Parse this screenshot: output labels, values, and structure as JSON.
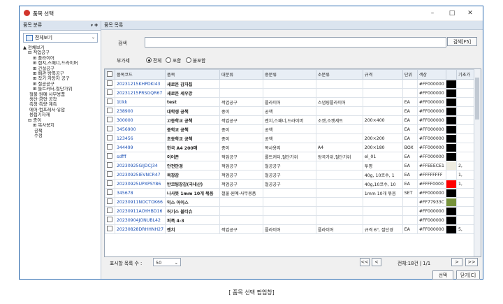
{
  "window": {
    "title": "품목 선택",
    "controls": [
      "–",
      "□",
      "✕"
    ]
  },
  "left_panel": {
    "header": "품목 분류",
    "header_tools": "▾ ✚",
    "select_label": "전체보기",
    "tree": [
      {
        "label": "전체보기",
        "indent": 0,
        "prefix": "▲"
      },
      {
        "label": "적업공구",
        "indent": 1,
        "prefix": "⊟"
      },
      {
        "label": "플라이어",
        "indent": 2,
        "prefix": "⊞"
      },
      {
        "label": "렌치,스패너,드라이버",
        "indent": 2,
        "prefix": "⊞"
      },
      {
        "label": "건설공구",
        "indent": 2,
        "prefix": "⊞"
      },
      {
        "label": "배관·방폭공구",
        "indent": 2,
        "prefix": "⊞"
      },
      {
        "label": "작기·자동차 공구",
        "indent": 2,
        "prefix": "⊞"
      },
      {
        "label": "절공공구",
        "indent": 2,
        "prefix": "⊞"
      },
      {
        "label": "툴트커터,절단가위",
        "indent": 2,
        "prefix": "⊞"
      },
      {
        "label": "철물·원예·사무용품",
        "indent": 1,
        "prefix": ""
      },
      {
        "label": "생산·금형·공작",
        "indent": 1,
        "prefix": ""
      },
      {
        "label": "측정·측량·계측",
        "indent": 1,
        "prefix": ""
      },
      {
        "label": "에어·컴프레서·유압",
        "indent": 1,
        "prefix": ""
      },
      {
        "label": "용접기자재",
        "indent": 1,
        "prefix": ""
      },
      {
        "label": "종이",
        "indent": 1,
        "prefix": "⊟"
      },
      {
        "label": "복사용지",
        "indent": 2,
        "prefix": "⊞"
      },
      {
        "label": "공책",
        "indent": 2,
        "prefix": ""
      },
      {
        "label": "수정",
        "indent": 2,
        "prefix": ""
      }
    ]
  },
  "right_panel": {
    "header": "품목 목록",
    "search_label": "검색",
    "search_button": "검색[F5]",
    "subtax_label": "부가세",
    "radios": [
      {
        "label": "전체",
        "checked": true
      },
      {
        "label": "포함",
        "checked": false
      },
      {
        "label": "불포함",
        "checked": false
      }
    ],
    "columns": [
      "품목코드",
      "품목",
      "대분류",
      "중분류",
      "소분류",
      "규격",
      "단위",
      "색상",
      "",
      "기초가"
    ],
    "rows": [
      {
        "code": "20231215KHPDKI43",
        "name": "새로운 감자칩",
        "l": "",
        "m": "",
        "s": "",
        "spec": "",
        "unit": "",
        "hex": "#FF000000",
        "swatch": "#000000",
        "price": ""
      },
      {
        "code": "20231215PRSGQR67",
        "name": "새로운 세우깡",
        "l": "",
        "m": "",
        "s": "",
        "spec": "",
        "unit": "",
        "hex": "#FF000000",
        "swatch": "#000000",
        "price": ""
      },
      {
        "code": "1tikk",
        "name": "test",
        "l": "적업공구",
        "m": "플라이어",
        "s": "스냅링플라이어",
        "spec": "",
        "unit": "EA",
        "hex": "#FF000000",
        "swatch": "#000000",
        "price": ""
      },
      {
        "code": "238900",
        "name": "대학생 공책",
        "l": "종이",
        "m": "공책",
        "s": "",
        "spec": "",
        "unit": "EA",
        "hex": "#FF000000",
        "swatch": "#000000",
        "price": ""
      },
      {
        "code": "300000",
        "name": "고등학교 공책",
        "l": "적업공구",
        "m": "렌치,스패너,드라이버",
        "s": "소켓,소켓세트",
        "spec": "200×400",
        "unit": "EA",
        "hex": "#FF000000",
        "swatch": "#000000",
        "price": ""
      },
      {
        "code": "3456900",
        "name": "중학교 공책",
        "l": "종이",
        "m": "공책",
        "s": "",
        "spec": "",
        "unit": "EA",
        "hex": "#FF000000",
        "swatch": "#000000",
        "price": ""
      },
      {
        "code": "123456",
        "name": "초등학교 공책",
        "l": "종이",
        "m": "공책",
        "s": "",
        "spec": "200×200",
        "unit": "EA",
        "hex": "#FF000000",
        "swatch": "#000000",
        "price": ""
      },
      {
        "code": "344499",
        "name": "한국 A4 200매",
        "l": "종이",
        "m": "복사용지",
        "s": "A4",
        "spec": "200×180",
        "unit": "BOX",
        "hex": "#FF000000",
        "swatch": "#000000",
        "price": ""
      },
      {
        "code": "sdfff",
        "name": "이어폰",
        "l": "적업공구",
        "m": "롤트커터,절단가위",
        "s": "왕곡가위,절단가위",
        "spec": "el_01",
        "unit": "EA",
        "hex": "#FF000000",
        "swatch": "#000000",
        "price": ""
      },
      {
        "code": "20230925GIJDCJ34",
        "name": "안전안경",
        "l": "적업공구",
        "m": "철공공구",
        "s": "",
        "spec": "투명",
        "unit": "EA",
        "hex": "#FFEEECE1",
        "swatch": "#EEECE1",
        "price": "2,"
      },
      {
        "code": "20230925IEVNCR47",
        "name": "목장갑",
        "l": "적업공구",
        "m": "철공공구",
        "s": "",
        "spec": "40g, 10코수, 1",
        "unit": "EA",
        "hex": "#FFFFFFFF",
        "swatch": "#FFFFFF",
        "price": "1,"
      },
      {
        "code": "20230925UPXPSY86",
        "name": "반코팅장갑(국내산)",
        "l": "적업공구",
        "m": "철공공구",
        "s": "",
        "spec": "40g,10코수, 10",
        "unit": "EA",
        "hex": "#FFFF0000",
        "swatch": "#FF0000",
        "price": "1,"
      },
      {
        "code": "345678",
        "name": "나사못 1mm 10개 묶음",
        "l": "철물·원예·사무용품",
        "m": "",
        "s": "",
        "spec": "1mm 10개 묶음",
        "unit": "SET",
        "hex": "#FF000000",
        "swatch": "#000000",
        "price": ""
      },
      {
        "code": "20230911NOCTOK66",
        "name": "믹스 아이스",
        "l": "",
        "m": "",
        "s": "",
        "spec": "",
        "unit": "",
        "hex": "#FF77933C",
        "swatch": "#77933C",
        "price": ""
      },
      {
        "code": "20230911AOYHBD16",
        "name": "허기스 블티슈",
        "l": "",
        "m": "",
        "s": "",
        "spec": "",
        "unit": "",
        "hex": "#FF000000",
        "swatch": "#000000",
        "price": ""
      },
      {
        "code": "20230904JONUBL42",
        "name": "퍼폭 4-3",
        "l": "",
        "m": "",
        "s": "",
        "spec": "",
        "unit": "",
        "hex": "#FF000000",
        "swatch": "#000000",
        "price": ""
      },
      {
        "code": "20230828DRHHNH27",
        "name": "렌치",
        "l": "적업공구",
        "m": "플라이어",
        "s": "플라이어",
        "spec": "규격 6\", 절단경",
        "unit": "EA",
        "hex": "#FF000000",
        "swatch": "#000000",
        "price": "5,"
      }
    ],
    "footer": {
      "rows_label": "표시할 목록 수 :",
      "rows_value": "50",
      "total": "전체:18건 | 1/1",
      "nav_first": "<<",
      "nav_prev": "<",
      "nav_next": ">",
      "nav_last": ">>"
    },
    "select_button": "선택",
    "close_button": "닫기[C]"
  },
  "caption": "[ 품목 선택 팝업창]"
}
